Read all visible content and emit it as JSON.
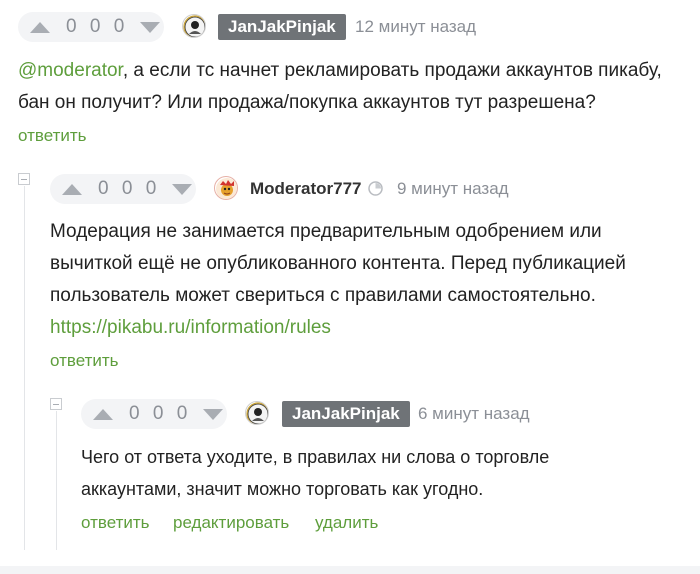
{
  "comments": [
    {
      "score": "0 0 0",
      "username": "JanJakPinjak",
      "time": "12 минут назад",
      "mention": "@moderator",
      "text_line1": ", а если тс начнет рекламировать продажи аккаунтов пикабу,",
      "text_line2": "бан он получит? Или продажа/покупка аккаунтов тут разрешена?",
      "actions": {
        "reply": "ответить"
      }
    },
    {
      "score": "0 0 0",
      "username": "Moderator777",
      "time": "9 минут назад",
      "text_line1": "Модерация не занимается предварительным одобрением или",
      "text_line2": "вычиткой ещё не опубликованного контента. Перед публикацией",
      "text_line3": "пользователь может свериться с правилами самостоятельно.",
      "link": "https://pikabu.ru/information/rules",
      "actions": {
        "reply": "ответить"
      }
    },
    {
      "score": "0 0 0",
      "username": "JanJakPinjak",
      "time": "6 минут назад",
      "text_line1": "Чего от ответа уходите, в правилах ни слова о торговле",
      "text_line2": "аккаунтами, значит можно торговать как угодно.",
      "actions": {
        "reply": "ответить",
        "edit": "редактировать",
        "delete": "удалить"
      }
    }
  ],
  "icons": {
    "vote_up": "arrow-up-icon",
    "vote_down": "arrow-down-icon",
    "moderator_status": "clock-status-icon",
    "collapse": "collapse-icon"
  },
  "colors": {
    "link_green": "#5e9e3c",
    "badge_bg": "#6f7377",
    "vote_bg": "#f3f4f6",
    "muted": "#8b8f96"
  }
}
